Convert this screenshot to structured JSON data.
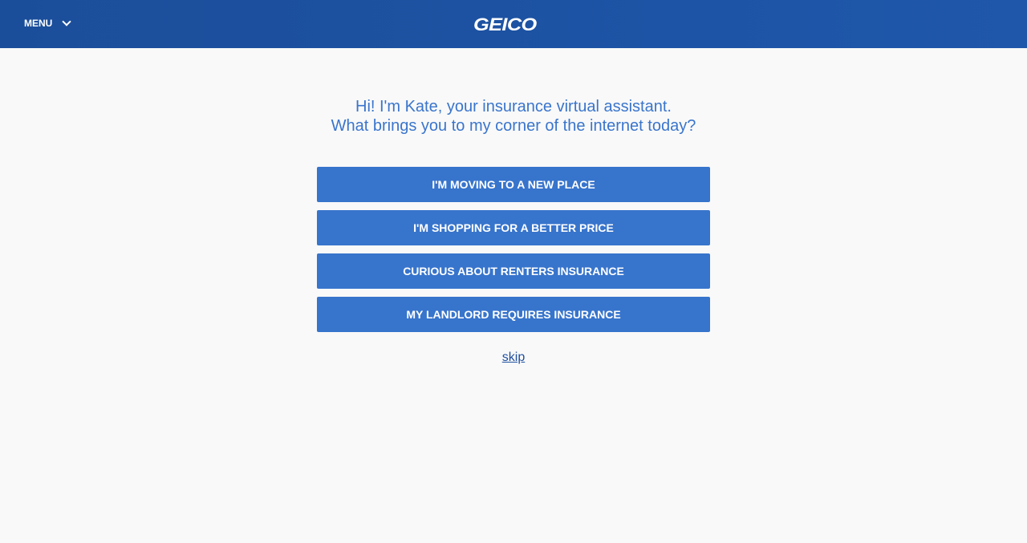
{
  "header": {
    "menu_label": "MENU",
    "logo": "GEICO"
  },
  "intro": {
    "line1": "Hi! I'm Kate, your insurance virtual assistant.",
    "line2": "What brings you to my corner of the internet today?"
  },
  "options": [
    "I'M MOVING TO A NEW PLACE",
    "I'M SHOPPING FOR A BETTER PRICE",
    "CURIOUS ABOUT RENTERS INSURANCE",
    "MY LANDLORD REQUIRES INSURANCE"
  ],
  "skip_label": "skip"
}
